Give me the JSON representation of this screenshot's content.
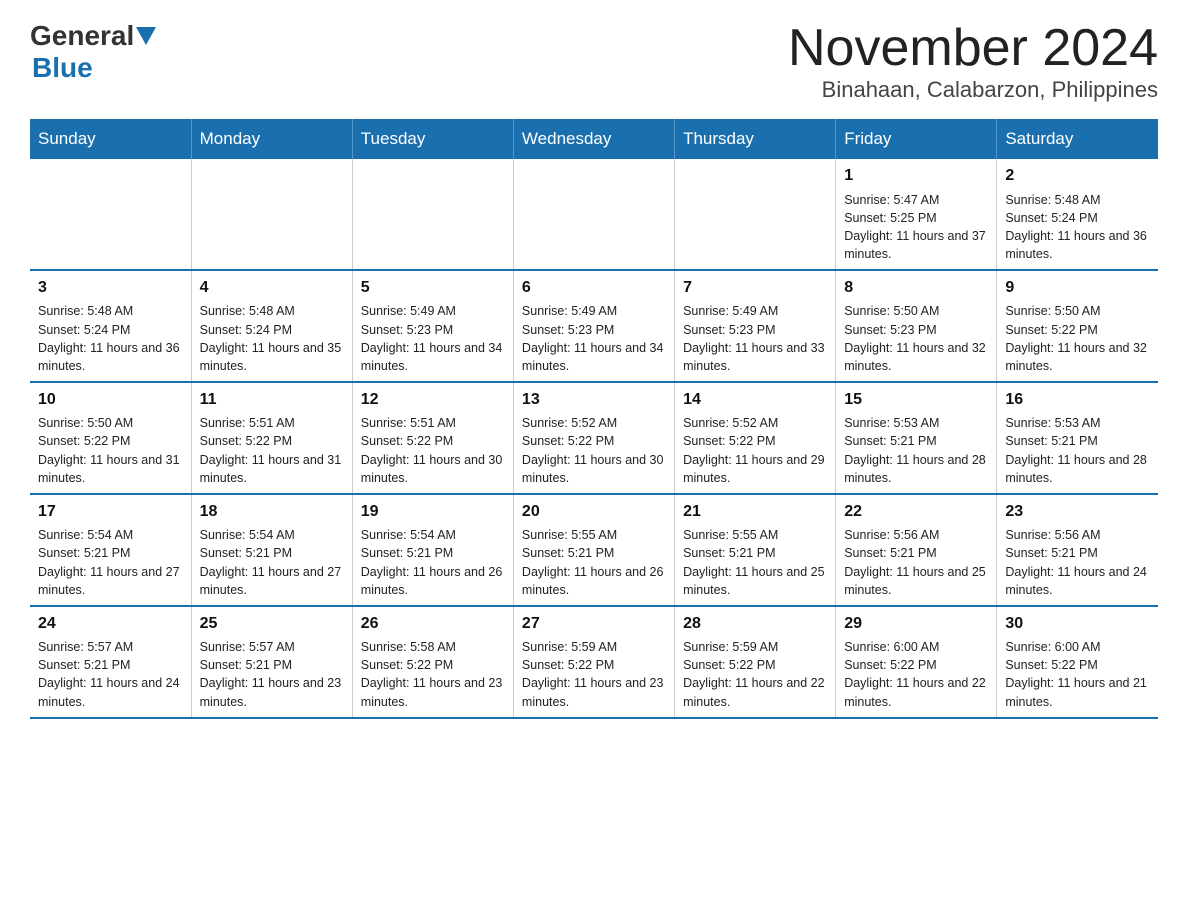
{
  "header": {
    "title": "November 2024",
    "subtitle": "Binahaan, Calabarzon, Philippines",
    "logo_general": "General",
    "logo_blue": "Blue"
  },
  "weekdays": [
    "Sunday",
    "Monday",
    "Tuesday",
    "Wednesday",
    "Thursday",
    "Friday",
    "Saturday"
  ],
  "weeks": [
    [
      {
        "day": "",
        "info": ""
      },
      {
        "day": "",
        "info": ""
      },
      {
        "day": "",
        "info": ""
      },
      {
        "day": "",
        "info": ""
      },
      {
        "day": "",
        "info": ""
      },
      {
        "day": "1",
        "info": "Sunrise: 5:47 AM\nSunset: 5:25 PM\nDaylight: 11 hours and 37 minutes."
      },
      {
        "day": "2",
        "info": "Sunrise: 5:48 AM\nSunset: 5:24 PM\nDaylight: 11 hours and 36 minutes."
      }
    ],
    [
      {
        "day": "3",
        "info": "Sunrise: 5:48 AM\nSunset: 5:24 PM\nDaylight: 11 hours and 36 minutes."
      },
      {
        "day": "4",
        "info": "Sunrise: 5:48 AM\nSunset: 5:24 PM\nDaylight: 11 hours and 35 minutes."
      },
      {
        "day": "5",
        "info": "Sunrise: 5:49 AM\nSunset: 5:23 PM\nDaylight: 11 hours and 34 minutes."
      },
      {
        "day": "6",
        "info": "Sunrise: 5:49 AM\nSunset: 5:23 PM\nDaylight: 11 hours and 34 minutes."
      },
      {
        "day": "7",
        "info": "Sunrise: 5:49 AM\nSunset: 5:23 PM\nDaylight: 11 hours and 33 minutes."
      },
      {
        "day": "8",
        "info": "Sunrise: 5:50 AM\nSunset: 5:23 PM\nDaylight: 11 hours and 32 minutes."
      },
      {
        "day": "9",
        "info": "Sunrise: 5:50 AM\nSunset: 5:22 PM\nDaylight: 11 hours and 32 minutes."
      }
    ],
    [
      {
        "day": "10",
        "info": "Sunrise: 5:50 AM\nSunset: 5:22 PM\nDaylight: 11 hours and 31 minutes."
      },
      {
        "day": "11",
        "info": "Sunrise: 5:51 AM\nSunset: 5:22 PM\nDaylight: 11 hours and 31 minutes."
      },
      {
        "day": "12",
        "info": "Sunrise: 5:51 AM\nSunset: 5:22 PM\nDaylight: 11 hours and 30 minutes."
      },
      {
        "day": "13",
        "info": "Sunrise: 5:52 AM\nSunset: 5:22 PM\nDaylight: 11 hours and 30 minutes."
      },
      {
        "day": "14",
        "info": "Sunrise: 5:52 AM\nSunset: 5:22 PM\nDaylight: 11 hours and 29 minutes."
      },
      {
        "day": "15",
        "info": "Sunrise: 5:53 AM\nSunset: 5:21 PM\nDaylight: 11 hours and 28 minutes."
      },
      {
        "day": "16",
        "info": "Sunrise: 5:53 AM\nSunset: 5:21 PM\nDaylight: 11 hours and 28 minutes."
      }
    ],
    [
      {
        "day": "17",
        "info": "Sunrise: 5:54 AM\nSunset: 5:21 PM\nDaylight: 11 hours and 27 minutes."
      },
      {
        "day": "18",
        "info": "Sunrise: 5:54 AM\nSunset: 5:21 PM\nDaylight: 11 hours and 27 minutes."
      },
      {
        "day": "19",
        "info": "Sunrise: 5:54 AM\nSunset: 5:21 PM\nDaylight: 11 hours and 26 minutes."
      },
      {
        "day": "20",
        "info": "Sunrise: 5:55 AM\nSunset: 5:21 PM\nDaylight: 11 hours and 26 minutes."
      },
      {
        "day": "21",
        "info": "Sunrise: 5:55 AM\nSunset: 5:21 PM\nDaylight: 11 hours and 25 minutes."
      },
      {
        "day": "22",
        "info": "Sunrise: 5:56 AM\nSunset: 5:21 PM\nDaylight: 11 hours and 25 minutes."
      },
      {
        "day": "23",
        "info": "Sunrise: 5:56 AM\nSunset: 5:21 PM\nDaylight: 11 hours and 24 minutes."
      }
    ],
    [
      {
        "day": "24",
        "info": "Sunrise: 5:57 AM\nSunset: 5:21 PM\nDaylight: 11 hours and 24 minutes."
      },
      {
        "day": "25",
        "info": "Sunrise: 5:57 AM\nSunset: 5:21 PM\nDaylight: 11 hours and 23 minutes."
      },
      {
        "day": "26",
        "info": "Sunrise: 5:58 AM\nSunset: 5:22 PM\nDaylight: 11 hours and 23 minutes."
      },
      {
        "day": "27",
        "info": "Sunrise: 5:59 AM\nSunset: 5:22 PM\nDaylight: 11 hours and 23 minutes."
      },
      {
        "day": "28",
        "info": "Sunrise: 5:59 AM\nSunset: 5:22 PM\nDaylight: 11 hours and 22 minutes."
      },
      {
        "day": "29",
        "info": "Sunrise: 6:00 AM\nSunset: 5:22 PM\nDaylight: 11 hours and 22 minutes."
      },
      {
        "day": "30",
        "info": "Sunrise: 6:00 AM\nSunset: 5:22 PM\nDaylight: 11 hours and 21 minutes."
      }
    ]
  ]
}
